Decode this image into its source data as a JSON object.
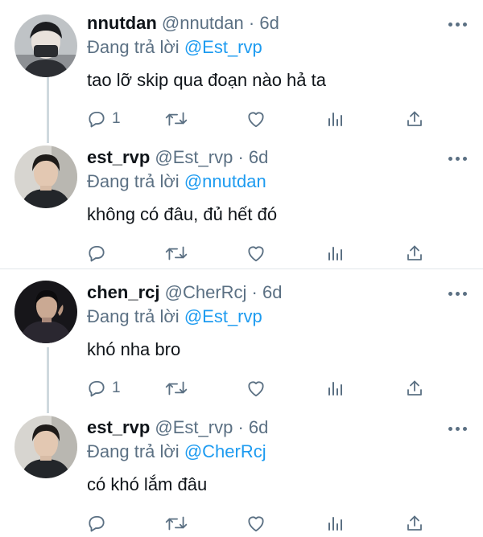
{
  "tweets": [
    {
      "name": "nnutdan",
      "handle": "@nnutdan",
      "sep": "·",
      "time": "6d",
      "replying_prefix": "Đang trả lời",
      "replying_to": "@Est_rvp",
      "text": "tao lỡ skip qua đoạn nào hả ta",
      "reply_count": "1",
      "avatar": "avatar-mask-photo"
    },
    {
      "name": "est_rvp",
      "handle": "@Est_rvp",
      "sep": "·",
      "time": "6d",
      "replying_prefix": "Đang trả lời",
      "replying_to": "@nnutdan",
      "text": "không có đâu, đủ hết đó",
      "reply_count": "",
      "avatar": "avatar-selfie-photo"
    },
    {
      "name": "chen_rcj",
      "handle": "@CherRcj",
      "sep": "·",
      "time": "6d",
      "replying_prefix": "Đang trả lời",
      "replying_to": "@Est_rvp",
      "text": "khó nha bro",
      "reply_count": "1",
      "avatar": "avatar-dark-portrait"
    },
    {
      "name": "est_rvp",
      "handle": "@Est_rvp",
      "sep": "·",
      "time": "6d",
      "replying_prefix": "Đang trả lời",
      "replying_to": "@CherRcj",
      "text": "có khó lắm đâu",
      "reply_count": "",
      "avatar": "avatar-selfie-photo"
    }
  ],
  "icons": {
    "reply": "reply-icon",
    "retweet": "retweet-icon",
    "like": "like-icon",
    "stats": "analytics-icon",
    "share": "share-icon",
    "more": "more-icon"
  },
  "colors": {
    "text": "#0f1419",
    "secondary": "#5b7083",
    "link": "#1d9bf0",
    "thread_line": "#cfd9de",
    "divider": "#e1e6ea"
  }
}
